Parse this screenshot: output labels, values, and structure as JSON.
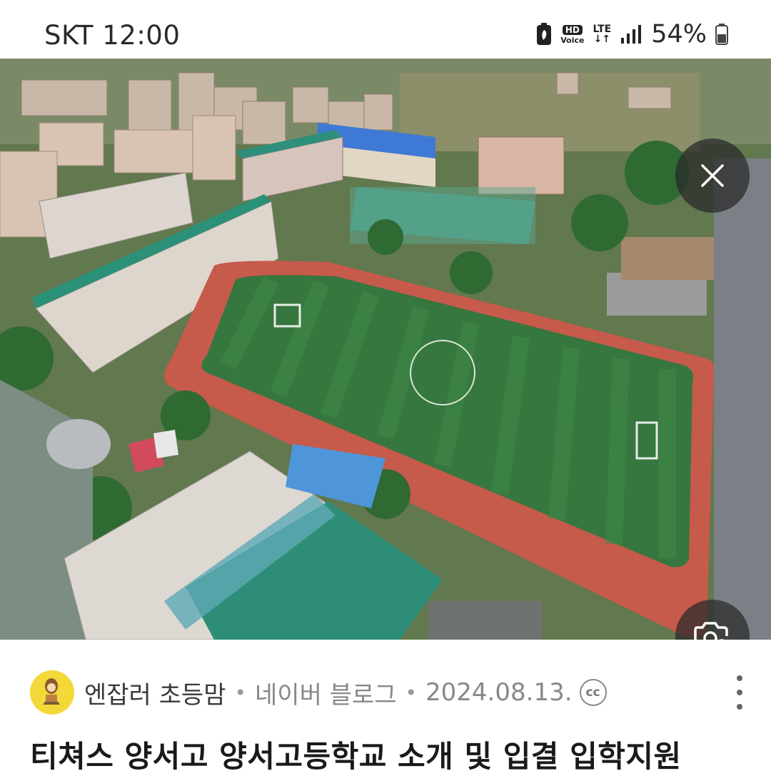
{
  "status_bar": {
    "carrier_time": "SKT 12:00",
    "hd_badge": "HD",
    "voice_label": "Voice",
    "network": "LTE",
    "battery_percent": "54%",
    "icons": [
      "battery-saver-icon",
      "hd-voice-icon",
      "lte-icon",
      "signal-icon",
      "battery-icon"
    ]
  },
  "image_viewer": {
    "close_icon": "close-icon",
    "lens_icon": "visual-search-icon"
  },
  "result": {
    "author": "엔잡러 초등맘",
    "separator": "•",
    "source": "네이버 블로그",
    "date": "2024.08.13.",
    "license_badge": "cc",
    "title": "티쳐스 양서고 양서고등학교 소개 및 입결 입학지원"
  }
}
